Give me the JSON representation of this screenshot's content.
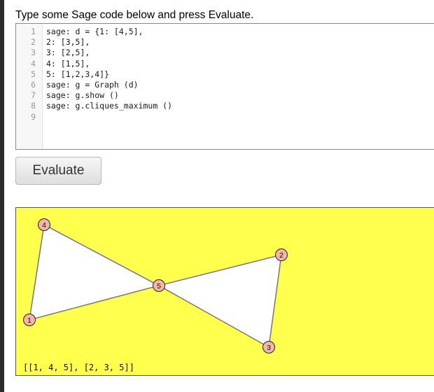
{
  "instructions": "Type some Sage code below and press Evaluate.",
  "editor": {
    "line_numbers": [
      "1",
      "2",
      "3",
      "4",
      "5",
      "6",
      "7",
      "8",
      "9"
    ],
    "lines": [
      "sage: d = {1: [4,5],",
      "2: [3,5],",
      "3: [2,5],",
      "4: [1,5],",
      "5: [1,2,3,4]}",
      "sage: g = Graph (d)",
      "sage: g.show ()",
      "sage: g.cliques_maximum ()",
      ""
    ]
  },
  "evaluate_button": {
    "label": "Evaluate"
  },
  "output": {
    "background_color": "#ffff4d",
    "graph": {
      "node_fill": "#f4b6a7",
      "edge_color": "#7d7d7d",
      "triangle_fill": "#ffffff",
      "nodes": [
        {
          "id": "1",
          "label": "1"
        },
        {
          "id": "2",
          "label": "2"
        },
        {
          "id": "3",
          "label": "3"
        },
        {
          "id": "4",
          "label": "4"
        },
        {
          "id": "5",
          "label": "5"
        }
      ],
      "edges": [
        [
          "1",
          "4"
        ],
        [
          "1",
          "5"
        ],
        [
          "4",
          "5"
        ],
        [
          "2",
          "3"
        ],
        [
          "2",
          "5"
        ],
        [
          "3",
          "5"
        ]
      ]
    },
    "result_text": "[[1, 4, 5], [2, 3, 5]]"
  }
}
